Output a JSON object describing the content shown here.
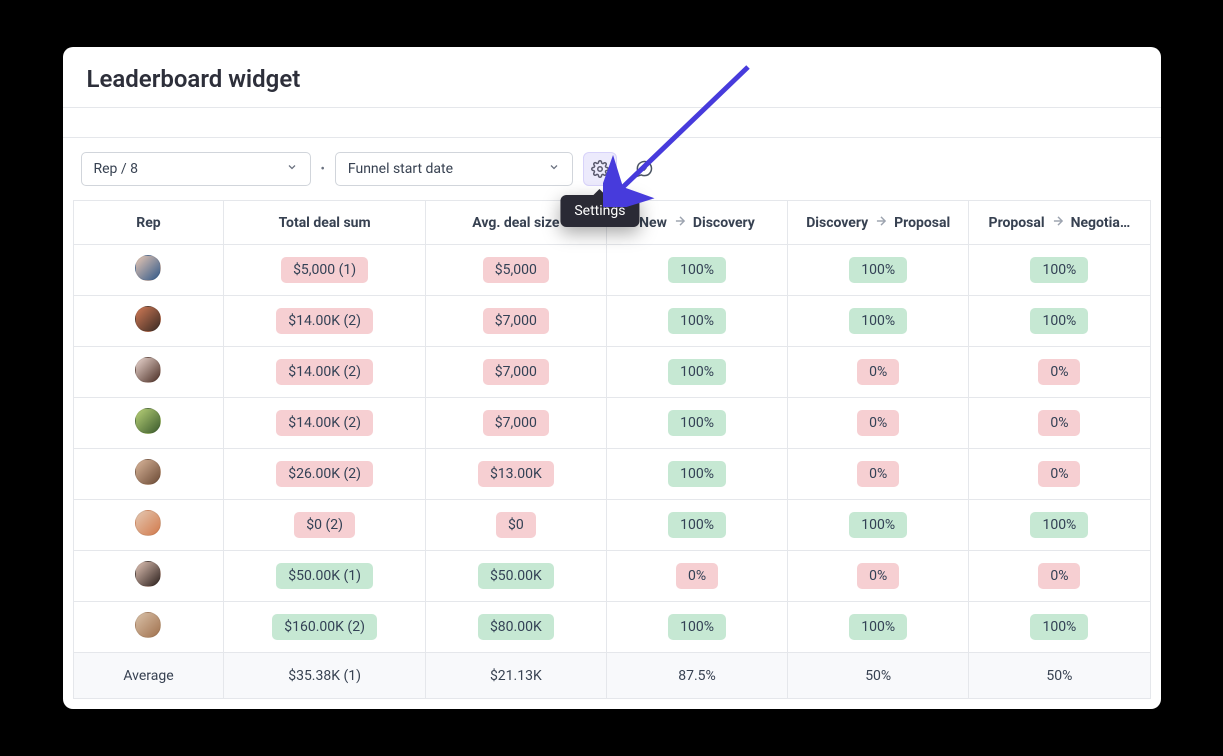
{
  "title": "Leaderboard widget",
  "toolbar": {
    "rep_select": "Rep / 8",
    "funnel_select": "Funnel start date",
    "settings_tooltip": "Settings"
  },
  "headers": {
    "rep": "Rep",
    "total": "Total deal sum",
    "avg": "Avg. deal size",
    "stage1_from": "New",
    "stage1_to": "Discovery",
    "stage2_from": "Discovery",
    "stage2_to": "Proposal",
    "stage3_from": "Proposal",
    "stage3_to": "Negotia…"
  },
  "rows": [
    {
      "avatar_c1": "#e8c8b4",
      "avatar_c2": "#2f5788",
      "total": "$5,000 (1)",
      "total_color": "red",
      "avg": "$5,000",
      "avg_color": "red",
      "s1": "100%",
      "s1c": "green",
      "s2": "100%",
      "s2c": "green",
      "s3": "100%",
      "s3c": "green"
    },
    {
      "avatar_c1": "#d07a56",
      "avatar_c2": "#3a2a23",
      "total": "$14.00K (2)",
      "total_color": "red",
      "avg": "$7,000",
      "avg_color": "red",
      "s1": "100%",
      "s1c": "green",
      "s2": "100%",
      "s2c": "green",
      "s3": "100%",
      "s3c": "green"
    },
    {
      "avatar_c1": "#ead6cf",
      "avatar_c2": "#4a2d24",
      "total": "$14.00K (2)",
      "total_color": "red",
      "avg": "$7,000",
      "avg_color": "red",
      "s1": "100%",
      "s1c": "green",
      "s2": "0%",
      "s2c": "red",
      "s3": "0%",
      "s3c": "red"
    },
    {
      "avatar_c1": "#b8d178",
      "avatar_c2": "#3a5a2c",
      "total": "$14.00K (2)",
      "total_color": "red",
      "avg": "$7,000",
      "avg_color": "red",
      "s1": "100%",
      "s1c": "green",
      "s2": "0%",
      "s2c": "red",
      "s3": "0%",
      "s3c": "red"
    },
    {
      "avatar_c1": "#d9b59a",
      "avatar_c2": "#6b4a35",
      "total": "$26.00K (2)",
      "total_color": "red",
      "avg": "$13.00K",
      "avg_color": "red",
      "s1": "100%",
      "s1c": "green",
      "s2": "0%",
      "s2c": "red",
      "s3": "0%",
      "s3c": "red"
    },
    {
      "avatar_c1": "#e4c7b1",
      "avatar_c2": "#d27a4c",
      "total": "$0 (2)",
      "total_color": "red",
      "avg": "$0",
      "avg_color": "red",
      "s1": "100%",
      "s1c": "green",
      "s2": "100%",
      "s2c": "green",
      "s3": "100%",
      "s3c": "green"
    },
    {
      "avatar_c1": "#e0c3b5",
      "avatar_c2": "#2a1e1b",
      "total": "$50.00K (1)",
      "total_color": "green",
      "avg": "$50.00K",
      "avg_color": "green",
      "s1": "0%",
      "s1c": "red",
      "s2": "0%",
      "s2c": "red",
      "s3": "0%",
      "s3c": "red"
    },
    {
      "avatar_c1": "#d9c1a8",
      "avatar_c2": "#a0714e",
      "total": "$160.00K (2)",
      "total_color": "green",
      "avg": "$80.00K",
      "avg_color": "green",
      "s1": "100%",
      "s1c": "green",
      "s2": "100%",
      "s2c": "green",
      "s3": "100%",
      "s3c": "green"
    }
  ],
  "average": {
    "label": "Average",
    "total": "$35.38K (1)",
    "avg": "$21.13K",
    "s1": "87.5%",
    "s2": "50%",
    "s3": "50%"
  }
}
